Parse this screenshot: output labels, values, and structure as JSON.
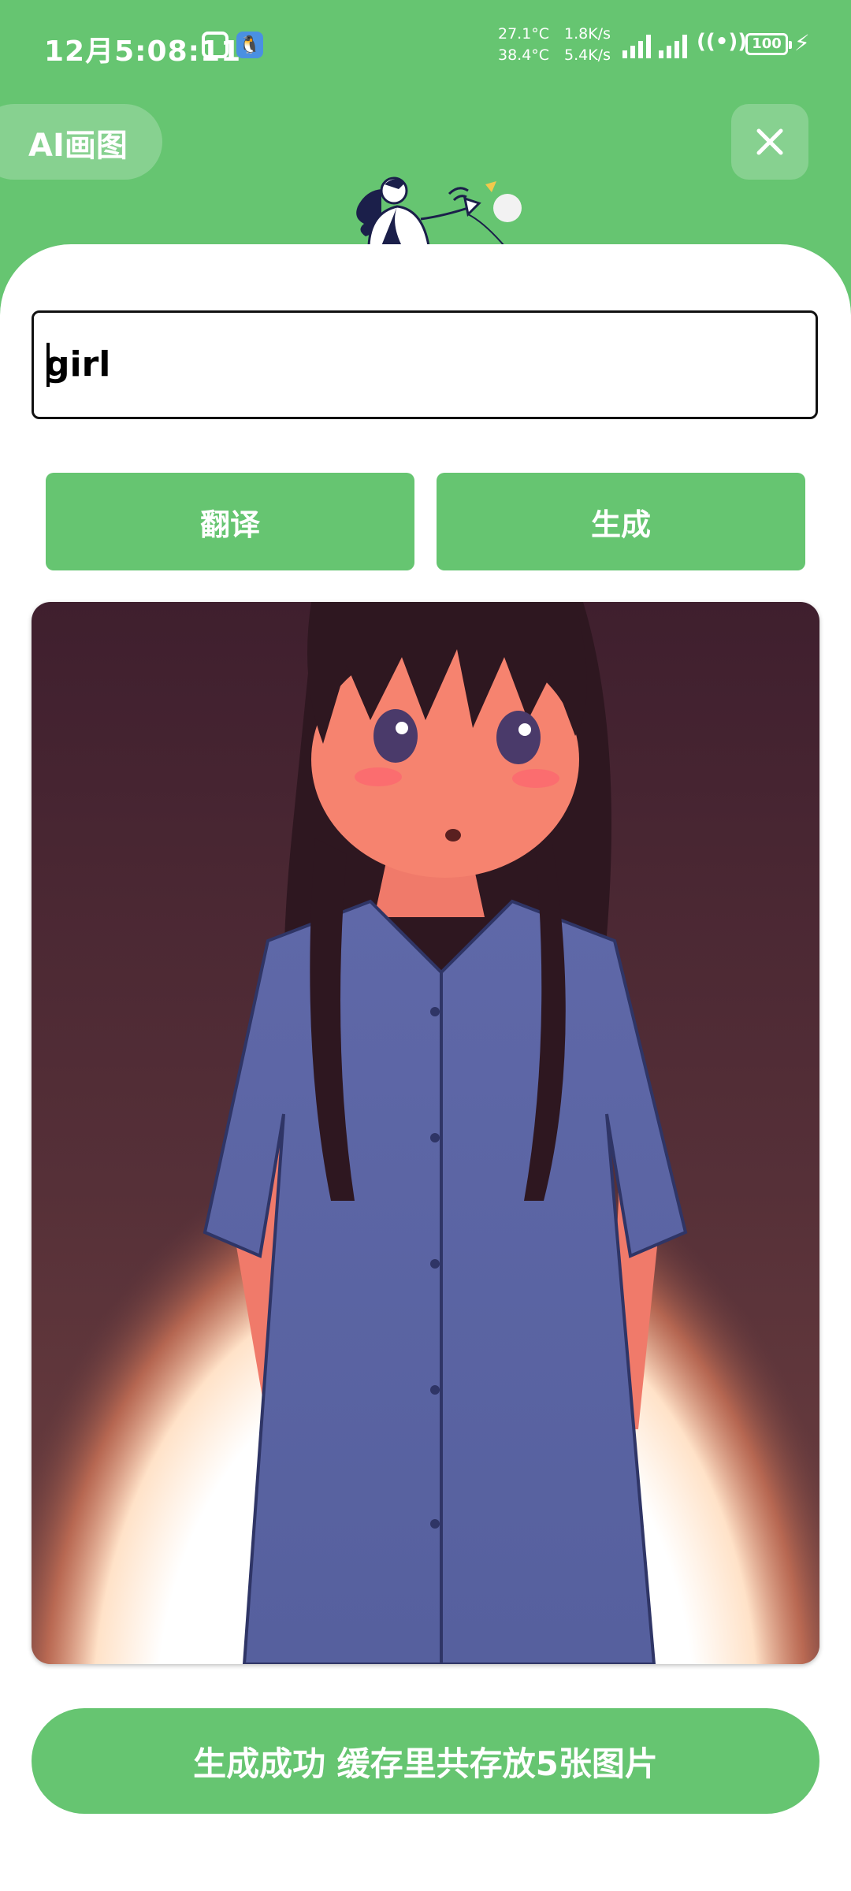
{
  "status_bar": {
    "time": "12月5:08:11",
    "cpu_temp": "27.1°C",
    "battery_temp": "38.4°C",
    "upload_speed": "1.8K/s",
    "download_speed": "5.4K/s",
    "battery": "100",
    "app_icons": [
      "notification-app-icon",
      "qq-penguin-icon"
    ]
  },
  "header": {
    "title": "AI画图"
  },
  "prompt": {
    "value": "girl",
    "placeholder": ""
  },
  "buttons": {
    "translate": "翻译",
    "generate": "生成"
  },
  "status_message": "生成成功 缓存里共存放5张图片",
  "colors": {
    "accent": "#66c571",
    "surface": "#ffffff"
  }
}
